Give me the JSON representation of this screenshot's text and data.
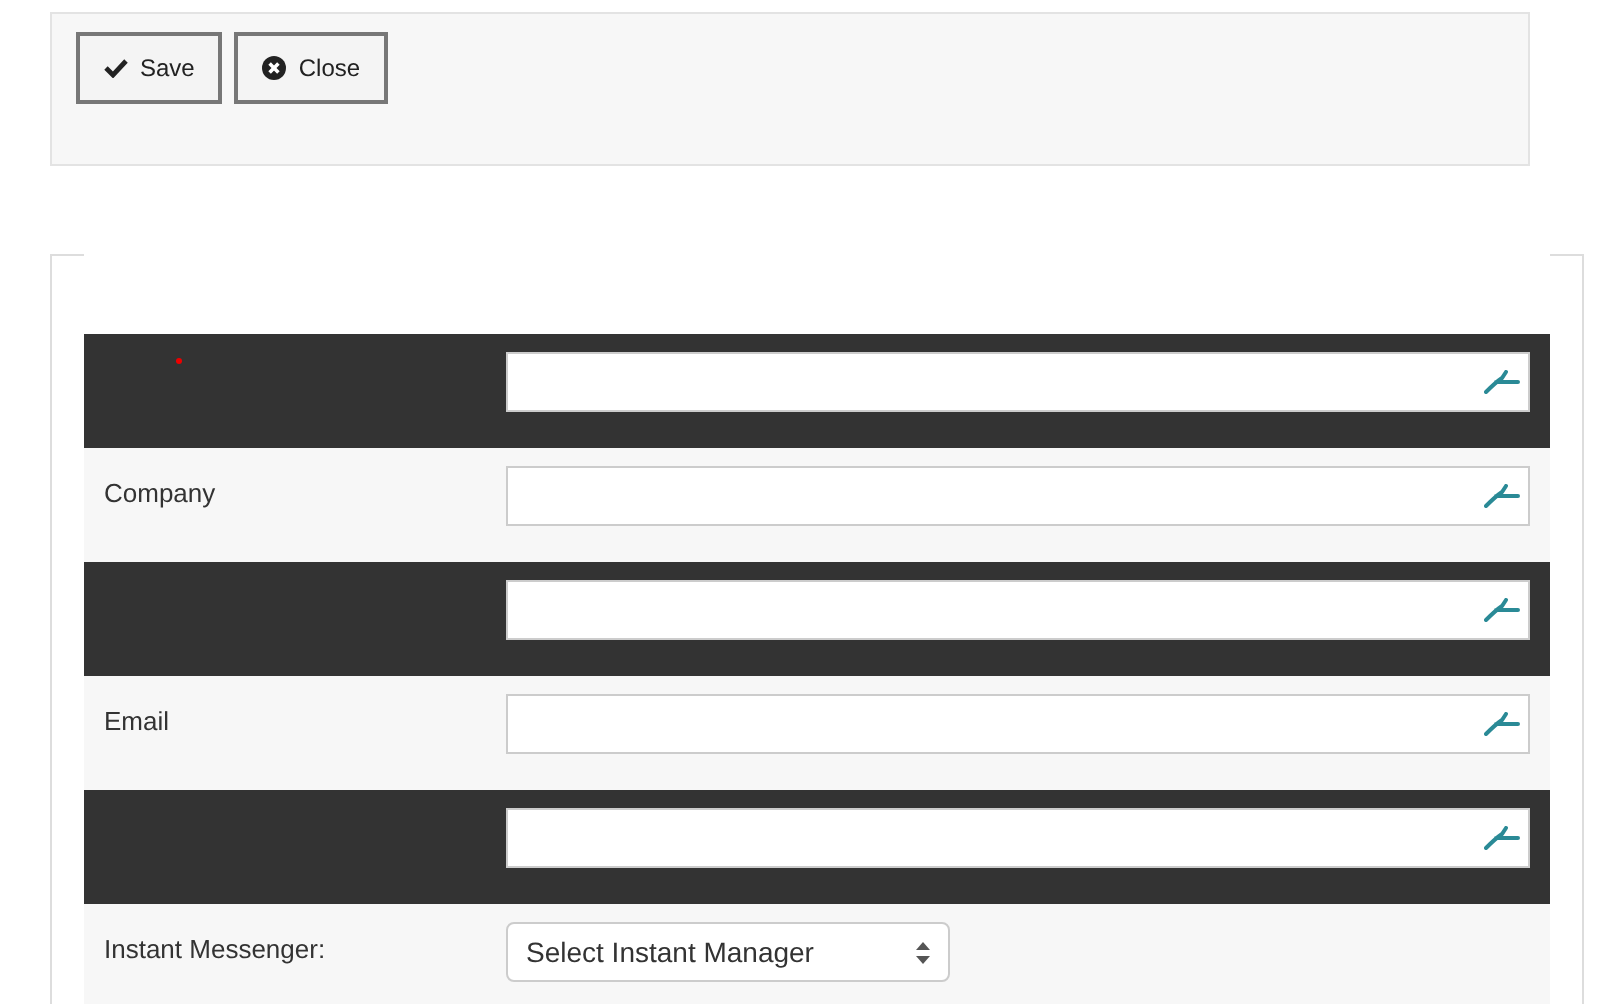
{
  "toolbar": {
    "buttons": [
      {
        "kind": "save",
        "label": "Save"
      },
      {
        "kind": "close",
        "label": "Close"
      }
    ]
  },
  "form": {
    "rows": [
      {
        "kind": "text",
        "dark": true,
        "required": true
      },
      {
        "kind": "text",
        "dark": false,
        "required": false,
        "label": "Company"
      },
      {
        "kind": "text",
        "dark": true,
        "required": false
      },
      {
        "kind": "text",
        "dark": false,
        "required": false,
        "label": "Email"
      },
      {
        "kind": "text",
        "dark": true,
        "required": false
      },
      {
        "kind": "select",
        "dark": false,
        "required": false,
        "label": "Instant Messenger:",
        "value": "Select Instant Manager"
      }
    ]
  }
}
